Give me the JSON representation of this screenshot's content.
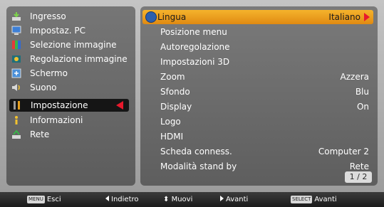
{
  "sidebar": {
    "items": [
      {
        "label": "Ingresso",
        "icon": "input-icon"
      },
      {
        "label": "Impostaz. PC",
        "icon": "pc-adjust-icon"
      },
      {
        "label": "Selezione immagine",
        "icon": "image-select-icon"
      },
      {
        "label": "Regolazione immagine",
        "icon": "image-adjust-icon"
      },
      {
        "label": "Schermo",
        "icon": "screen-icon"
      },
      {
        "label": "Suono",
        "icon": "sound-icon"
      },
      {
        "label": "Impostazione",
        "icon": "settings-icon",
        "selected": true
      },
      {
        "label": "Informazioni",
        "icon": "info-icon"
      },
      {
        "label": "Rete",
        "icon": "network-icon"
      }
    ]
  },
  "settings": {
    "rows": [
      {
        "label": "Lingua",
        "value": "Italiano",
        "highlighted": true
      },
      {
        "label": "Posizione menu",
        "value": ""
      },
      {
        "label": "Autoregolazione",
        "value": ""
      },
      {
        "label": "Impostazioni 3D",
        "value": ""
      },
      {
        "label": "Zoom",
        "value": "Azzera"
      },
      {
        "label": "Sfondo",
        "value": "Blu"
      },
      {
        "label": "Display",
        "value": "On"
      },
      {
        "label": "Logo",
        "value": ""
      },
      {
        "label": "HDMI",
        "value": ""
      },
      {
        "label": "Scheda conness.",
        "value": "Computer 2"
      },
      {
        "label": "Modalità stand by",
        "value": "Rete"
      }
    ],
    "page_indicator": "1 / 2"
  },
  "bottom_bar": {
    "menu_key": "MENU",
    "exit_label": "Esci",
    "back_label": "Indietro",
    "move_label": "Muovi",
    "forward_label": "Avanti",
    "select_key": "SELECT",
    "select_label": "Avanti"
  },
  "colors": {
    "highlight": "#f0a020",
    "arrow": "#e8192c",
    "panel": "#6a6a6a"
  }
}
